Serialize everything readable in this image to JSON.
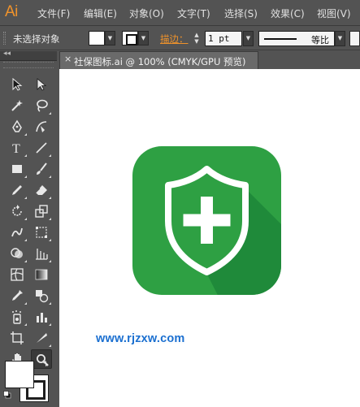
{
  "app": {
    "logo": "Ai"
  },
  "menu": [
    "文件(F)",
    "编辑(E)",
    "对象(O)",
    "文字(T)",
    "选择(S)",
    "效果(C)",
    "视图(V)"
  ],
  "control_bar": {
    "selection_status": "未选择对象",
    "stroke_label": "描边：",
    "stroke_weight": "1 pt",
    "stroke_profile": "等比"
  },
  "tools_panel": {
    "collapse_glyph": "◂◂",
    "tools": [
      {
        "name": "selection-tool-icon"
      },
      {
        "name": "direct-selection-tool-icon"
      },
      {
        "name": "magic-wand-tool-icon"
      },
      {
        "name": "lasso-tool-icon"
      },
      {
        "name": "pen-tool-icon"
      },
      {
        "name": "curvature-pen-tool-icon"
      },
      {
        "name": "type-tool-icon",
        "glyph": "T"
      },
      {
        "name": "line-segment-tool-icon"
      },
      {
        "name": "rectangle-tool-icon"
      },
      {
        "name": "paintbrush-tool-icon"
      },
      {
        "name": "pencil-tool-icon"
      },
      {
        "name": "eraser-tool-icon"
      },
      {
        "name": "rotate-tool-icon"
      },
      {
        "name": "scale-tool-icon"
      },
      {
        "name": "warp-tool-icon"
      },
      {
        "name": "free-transform-tool-icon"
      },
      {
        "name": "shape-builder-tool-icon"
      },
      {
        "name": "perspective-grid-tool-icon"
      },
      {
        "name": "mesh-tool-icon"
      },
      {
        "name": "gradient-tool-icon"
      },
      {
        "name": "eyedropper-tool-icon"
      },
      {
        "name": "blend-tool-icon"
      },
      {
        "name": "symbol-sprayer-tool-icon"
      },
      {
        "name": "column-graph-tool-icon"
      },
      {
        "name": "artboard-tool-icon"
      },
      {
        "name": "slice-tool-icon"
      },
      {
        "name": "hand-tool-icon"
      },
      {
        "name": "zoom-tool-icon"
      }
    ],
    "active_tool": "zoom-tool-icon",
    "fill_color": "#ffffff",
    "stroke_color": "#000000"
  },
  "document": {
    "tab_close": "×",
    "tab_title": "社保图标.ai @ 100% (CMYK/GPU 预览)"
  },
  "artwork": {
    "icon": "shield-plus-icon",
    "background_color": "#2ea043",
    "shadow_color": "#1f8a3a",
    "shield_fill": "#2ea043",
    "shield_stroke": "#ffffff",
    "plus_color": "#ffffff"
  },
  "watermark": "www.rjzxw.com"
}
